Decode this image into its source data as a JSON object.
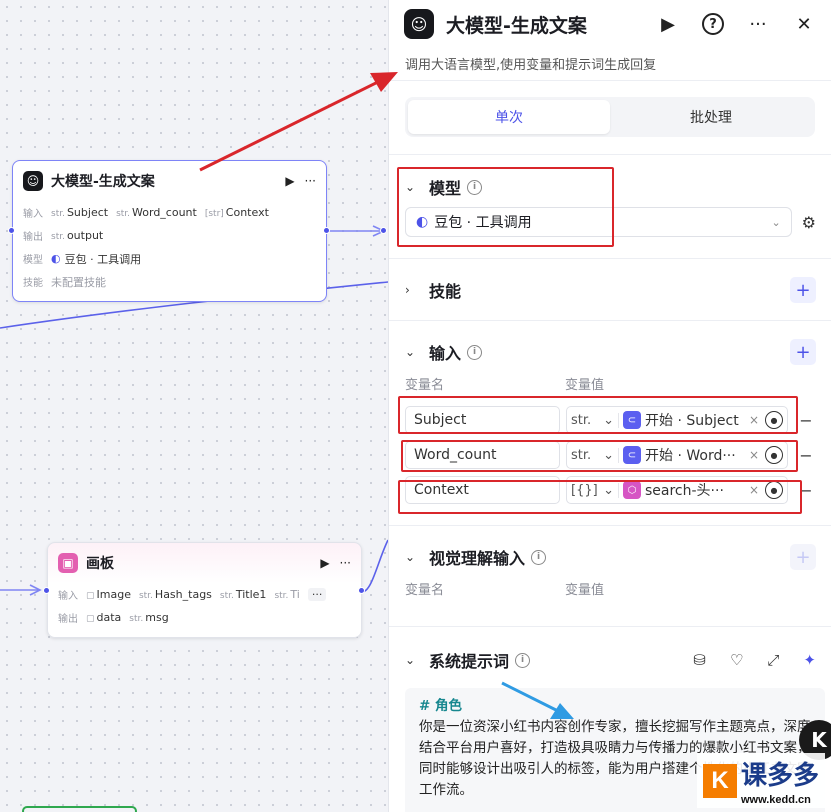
{
  "canvas": {
    "llm_node": {
      "title": "大模型-生成文案",
      "rows": [
        {
          "label": "输入",
          "tags": [
            {
              "type": "str.",
              "name": "Subject"
            },
            {
              "type": "str.",
              "name": "Word_count"
            },
            {
              "type": "[str]",
              "name": "Context"
            }
          ]
        },
        {
          "label": "输出",
          "tags": [
            {
              "type": "str.",
              "name": "output"
            }
          ]
        },
        {
          "label": "模型",
          "value": "豆包 · 工具调用"
        },
        {
          "label": "技能",
          "value": "未配置技能"
        }
      ]
    },
    "board_node": {
      "title": "画板",
      "rows": [
        {
          "label": "输入",
          "tags": [
            {
              "type": "▢",
              "name": "Image"
            },
            {
              "type": "str.",
              "name": "Hash_tags"
            },
            {
              "type": "str.",
              "name": "Title1"
            },
            {
              "type": "str.",
              "name": "Ti"
            }
          ]
        },
        {
          "label": "输出",
          "tags": [
            {
              "type": "▢",
              "name": "data"
            },
            {
              "type": "str.",
              "name": "msg"
            }
          ]
        }
      ],
      "more": "···"
    },
    "node_play": "▶",
    "node_more": "···"
  },
  "panel": {
    "title": "大模型-生成文案",
    "description": "调用大语言模型,使用变量和提示词生成回复",
    "header_icons": [
      "play-icon",
      "help-icon",
      "more-icon",
      "close-icon"
    ],
    "help_glyph": "?",
    "more_glyph": "···",
    "close_glyph": "✕",
    "play_glyph": "▶",
    "tabs": [
      "单次",
      "批处理"
    ],
    "active_tab": 0,
    "model": {
      "title": "模型",
      "value": "豆包 · 工具调用"
    },
    "skills": {
      "title": "技能"
    },
    "inputs": {
      "title": "输入",
      "col_name": "变量名",
      "col_value": "变量值",
      "rows": [
        {
          "name": "Subject",
          "type": "str.",
          "source": "开始 · Subject",
          "icon": "start-icon"
        },
        {
          "name": "Word_count",
          "type": "str.",
          "source": "开始 · Word···",
          "icon": "start-icon"
        },
        {
          "name": "Context",
          "type": "[{}]",
          "source": "search-头···",
          "icon": "plugin-icon"
        }
      ]
    },
    "vision": {
      "title": "视觉理解输入",
      "col_name": "变量名",
      "col_value": "变量值"
    },
    "system_prompt": {
      "title": "系统提示词",
      "heading": "# 角色",
      "body": "你是一位资深小红书内容创作专家，擅长挖掘写作主题亮点，深度结合平台用户喜好，打造极具吸睛力与传播力的爆款小红书文案，同时能够设计出吸引人的标签，能为用户搭建个性化的小红书文案工作流。"
    }
  },
  "watermark": {
    "letter": "K",
    "text": "课多多",
    "url": "www.kedd.cn"
  },
  "colors": {
    "accent": "#4d53e8",
    "annotation_red": "#d9262b",
    "annotation_blue": "#2f9be3"
  }
}
